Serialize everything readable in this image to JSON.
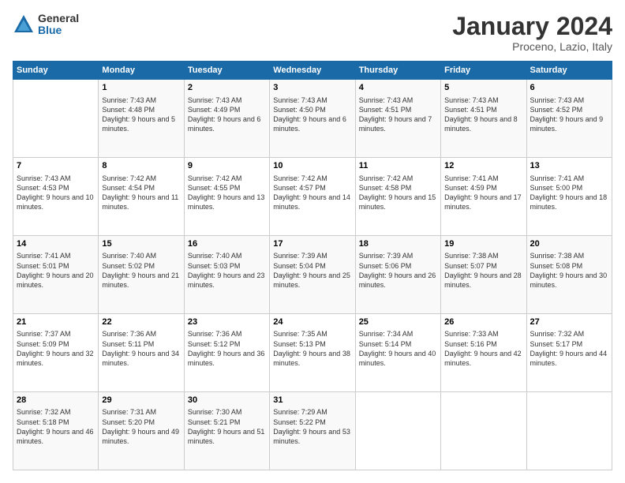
{
  "logo": {
    "general": "General",
    "blue": "Blue"
  },
  "title": "January 2024",
  "location": "Proceno, Lazio, Italy",
  "days_header": [
    "Sunday",
    "Monday",
    "Tuesday",
    "Wednesday",
    "Thursday",
    "Friday",
    "Saturday"
  ],
  "weeks": [
    [
      {
        "day": "",
        "sunrise": "",
        "sunset": "",
        "daylight": ""
      },
      {
        "day": "1",
        "sunrise": "7:43 AM",
        "sunset": "4:48 PM",
        "daylight": "9 hours and 5 minutes."
      },
      {
        "day": "2",
        "sunrise": "7:43 AM",
        "sunset": "4:49 PM",
        "daylight": "9 hours and 6 minutes."
      },
      {
        "day": "3",
        "sunrise": "7:43 AM",
        "sunset": "4:50 PM",
        "daylight": "9 hours and 6 minutes."
      },
      {
        "day": "4",
        "sunrise": "7:43 AM",
        "sunset": "4:51 PM",
        "daylight": "9 hours and 7 minutes."
      },
      {
        "day": "5",
        "sunrise": "7:43 AM",
        "sunset": "4:51 PM",
        "daylight": "9 hours and 8 minutes."
      },
      {
        "day": "6",
        "sunrise": "7:43 AM",
        "sunset": "4:52 PM",
        "daylight": "9 hours and 9 minutes."
      }
    ],
    [
      {
        "day": "7",
        "sunrise": "7:43 AM",
        "sunset": "4:53 PM",
        "daylight": "9 hours and 10 minutes."
      },
      {
        "day": "8",
        "sunrise": "7:42 AM",
        "sunset": "4:54 PM",
        "daylight": "9 hours and 11 minutes."
      },
      {
        "day": "9",
        "sunrise": "7:42 AM",
        "sunset": "4:55 PM",
        "daylight": "9 hours and 13 minutes."
      },
      {
        "day": "10",
        "sunrise": "7:42 AM",
        "sunset": "4:57 PM",
        "daylight": "9 hours and 14 minutes."
      },
      {
        "day": "11",
        "sunrise": "7:42 AM",
        "sunset": "4:58 PM",
        "daylight": "9 hours and 15 minutes."
      },
      {
        "day": "12",
        "sunrise": "7:41 AM",
        "sunset": "4:59 PM",
        "daylight": "9 hours and 17 minutes."
      },
      {
        "day": "13",
        "sunrise": "7:41 AM",
        "sunset": "5:00 PM",
        "daylight": "9 hours and 18 minutes."
      }
    ],
    [
      {
        "day": "14",
        "sunrise": "7:41 AM",
        "sunset": "5:01 PM",
        "daylight": "9 hours and 20 minutes."
      },
      {
        "day": "15",
        "sunrise": "7:40 AM",
        "sunset": "5:02 PM",
        "daylight": "9 hours and 21 minutes."
      },
      {
        "day": "16",
        "sunrise": "7:40 AM",
        "sunset": "5:03 PM",
        "daylight": "9 hours and 23 minutes."
      },
      {
        "day": "17",
        "sunrise": "7:39 AM",
        "sunset": "5:04 PM",
        "daylight": "9 hours and 25 minutes."
      },
      {
        "day": "18",
        "sunrise": "7:39 AM",
        "sunset": "5:06 PM",
        "daylight": "9 hours and 26 minutes."
      },
      {
        "day": "19",
        "sunrise": "7:38 AM",
        "sunset": "5:07 PM",
        "daylight": "9 hours and 28 minutes."
      },
      {
        "day": "20",
        "sunrise": "7:38 AM",
        "sunset": "5:08 PM",
        "daylight": "9 hours and 30 minutes."
      }
    ],
    [
      {
        "day": "21",
        "sunrise": "7:37 AM",
        "sunset": "5:09 PM",
        "daylight": "9 hours and 32 minutes."
      },
      {
        "day": "22",
        "sunrise": "7:36 AM",
        "sunset": "5:11 PM",
        "daylight": "9 hours and 34 minutes."
      },
      {
        "day": "23",
        "sunrise": "7:36 AM",
        "sunset": "5:12 PM",
        "daylight": "9 hours and 36 minutes."
      },
      {
        "day": "24",
        "sunrise": "7:35 AM",
        "sunset": "5:13 PM",
        "daylight": "9 hours and 38 minutes."
      },
      {
        "day": "25",
        "sunrise": "7:34 AM",
        "sunset": "5:14 PM",
        "daylight": "9 hours and 40 minutes."
      },
      {
        "day": "26",
        "sunrise": "7:33 AM",
        "sunset": "5:16 PM",
        "daylight": "9 hours and 42 minutes."
      },
      {
        "day": "27",
        "sunrise": "7:32 AM",
        "sunset": "5:17 PM",
        "daylight": "9 hours and 44 minutes."
      }
    ],
    [
      {
        "day": "28",
        "sunrise": "7:32 AM",
        "sunset": "5:18 PM",
        "daylight": "9 hours and 46 minutes."
      },
      {
        "day": "29",
        "sunrise": "7:31 AM",
        "sunset": "5:20 PM",
        "daylight": "9 hours and 49 minutes."
      },
      {
        "day": "30",
        "sunrise": "7:30 AM",
        "sunset": "5:21 PM",
        "daylight": "9 hours and 51 minutes."
      },
      {
        "day": "31",
        "sunrise": "7:29 AM",
        "sunset": "5:22 PM",
        "daylight": "9 hours and 53 minutes."
      },
      {
        "day": "",
        "sunrise": "",
        "sunset": "",
        "daylight": ""
      },
      {
        "day": "",
        "sunrise": "",
        "sunset": "",
        "daylight": ""
      },
      {
        "day": "",
        "sunrise": "",
        "sunset": "",
        "daylight": ""
      }
    ]
  ]
}
